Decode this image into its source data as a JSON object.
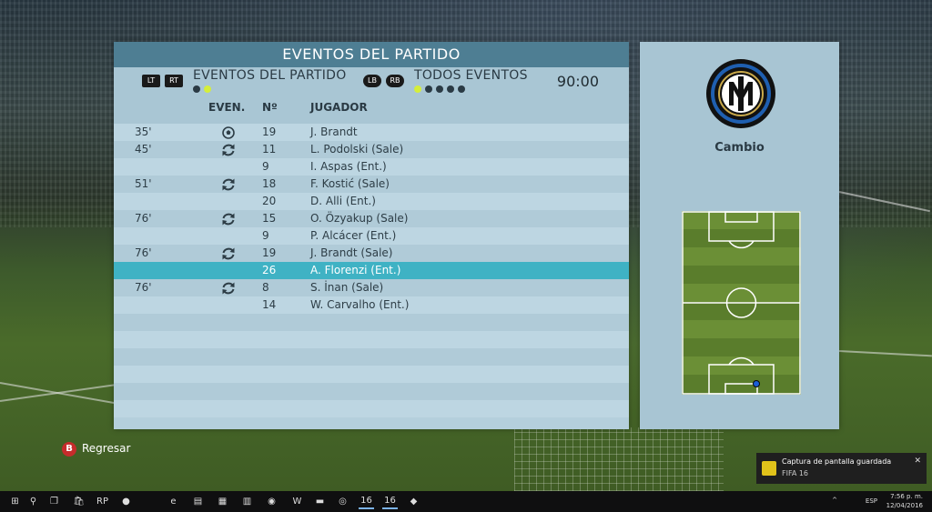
{
  "panel": {
    "title": "EVENTOS DEL PARTIDO",
    "left_buttons": [
      "LT",
      "RT"
    ],
    "left_filter_label": "EVENTOS DEL PARTIDO",
    "right_buttons": [
      "LB",
      "RB"
    ],
    "right_filter_label": "TODOS EVENTOS",
    "clock": "90:00",
    "left_page_dots": 2,
    "left_active_dot": 1,
    "right_page_dots": 5,
    "right_active_dot": 0
  },
  "columns": {
    "event": "EVEN.",
    "number": "Nº",
    "player": "JUGADOR"
  },
  "rows": [
    {
      "minute": "35'",
      "event": "goal-icon",
      "number": "19",
      "player": "J. Brandt",
      "selected": false
    },
    {
      "minute": "45'",
      "event": "substitution-icon",
      "number": "11",
      "player": "L. Podolski (Sale)",
      "selected": false
    },
    {
      "minute": "",
      "event": "",
      "number": "9",
      "player": "I. Aspas (Ent.)",
      "selected": false
    },
    {
      "minute": "51'",
      "event": "substitution-icon",
      "number": "18",
      "player": "F. Kostić (Sale)",
      "selected": false
    },
    {
      "minute": "",
      "event": "",
      "number": "20",
      "player": "D. Alli (Ent.)",
      "selected": false
    },
    {
      "minute": "76'",
      "event": "substitution-icon",
      "number": "15",
      "player": "O. Özyakup (Sale)",
      "selected": false
    },
    {
      "minute": "",
      "event": "",
      "number": "9",
      "player": "P. Alcácer (Ent.)",
      "selected": false
    },
    {
      "minute": "76'",
      "event": "substitution-icon",
      "number": "19",
      "player": "J. Brandt (Sale)",
      "selected": false
    },
    {
      "minute": "",
      "event": "",
      "number": "26",
      "player": "A. Florenzi (Ent.)",
      "selected": true
    },
    {
      "minute": "76'",
      "event": "substitution-icon",
      "number": "8",
      "player": "S. İnan (Sale)",
      "selected": false
    },
    {
      "minute": "",
      "event": "",
      "number": "14",
      "player": "W. Carvalho (Ent.)",
      "selected": false
    },
    {
      "minute": "",
      "event": "",
      "number": "",
      "player": "",
      "selected": false
    },
    {
      "minute": "",
      "event": "",
      "number": "",
      "player": "",
      "selected": false
    },
    {
      "minute": "",
      "event": "",
      "number": "",
      "player": "",
      "selected": false
    },
    {
      "minute": "",
      "event": "",
      "number": "",
      "player": "",
      "selected": false
    },
    {
      "minute": "",
      "event": "",
      "number": "",
      "player": "",
      "selected": false
    },
    {
      "minute": "",
      "event": "",
      "number": "",
      "player": "",
      "selected": false
    }
  ],
  "detail": {
    "crest_icon": "inter-milan-crest-icon",
    "crest_letters": "FCIM",
    "event_label": "Cambio",
    "player_marker_color": "#1a5fd6"
  },
  "back": {
    "button": "B",
    "label": "Regresar"
  },
  "toast": {
    "title": "Captura de pantalla guardada",
    "subtitle": "FIFA 16",
    "close": "✕"
  },
  "taskbar": {
    "icons": [
      "start-icon",
      "search-icon",
      "task-view-icon",
      "store-icon",
      "app-rp-icon",
      "app-orange-icon",
      "edge-icon",
      "explorer-icon",
      "app-window-icon",
      "calculator-icon",
      "app-helmet-icon",
      "word-icon",
      "folder-icon",
      "chrome-icon",
      "fifa16-icon",
      "fifa16-icon",
      "app-red-icon"
    ],
    "icon_glyphs": [
      "⊞",
      "⚲",
      "❐",
      "🛍",
      "RP",
      "●",
      "e",
      "▤",
      "▦",
      "▥",
      "◉",
      "W",
      "▬",
      "◎",
      "16",
      "16",
      "◆"
    ],
    "language": "ESP",
    "time": "7:56 p. m.",
    "date": "12/04/2016"
  },
  "colors": {
    "title_bar": "#4e7e93",
    "panel_bg": "#b4cfdc",
    "selected_row": "#3fb2c4",
    "active_dot": "#d5ee3a"
  }
}
